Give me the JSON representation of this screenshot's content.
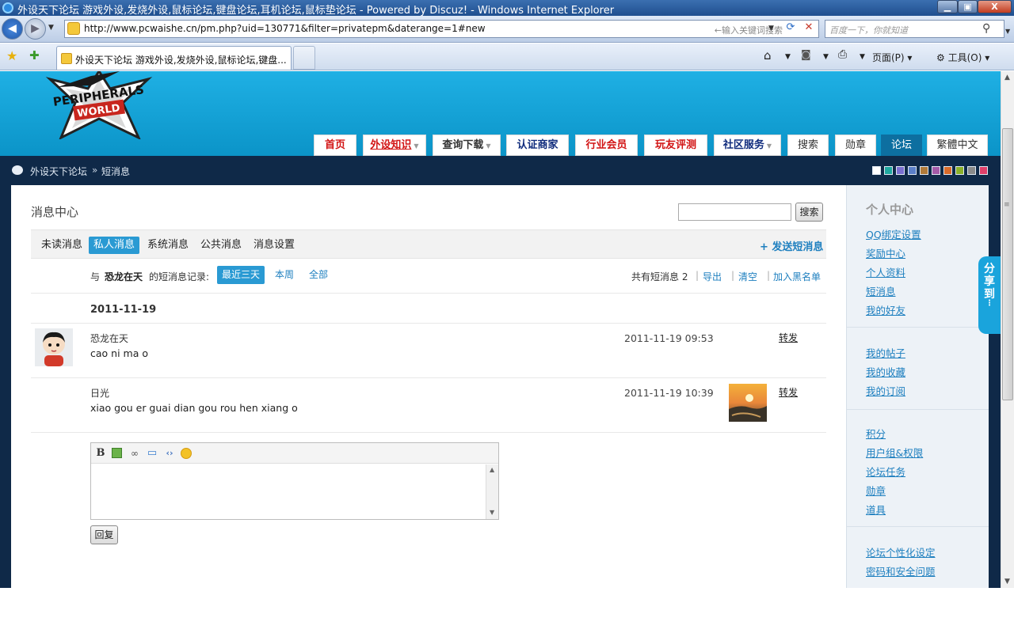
{
  "window": {
    "title": "外设天下论坛 游戏外设,发烧外设,鼠标论坛,键盘论坛,耳机论坛,鼠标垫论坛 - Powered by Discuz! - Windows Internet Explorer",
    "min": "▁",
    "max": "▣",
    "close": "X"
  },
  "browser": {
    "url": "http://www.pcwaishe.cn/pm.php?uid=130771&filter=privatepm&daterange=1#new",
    "address_hint": "←输入关键词搜索",
    "search_placeholder": "百度一下，你就知道",
    "tab_title": "外设天下论坛 游戏外设,发烧外设,鼠标论坛,键盘...",
    "cmd_page": "页面(P) ▾",
    "cmd_tools": "⚙ 工具(O) ▾"
  },
  "site": {
    "logo_text": "PERIPHERALS WORLD",
    "nav": [
      {
        "label": "首页"
      },
      {
        "label": "外设知识"
      },
      {
        "label": "查询下载"
      },
      {
        "label": "认证商家"
      },
      {
        "label": "行业会员"
      },
      {
        "label": "玩友评测"
      },
      {
        "label": "社区服务"
      },
      {
        "label": "搜索"
      },
      {
        "label": "勋章"
      },
      {
        "label": "论坛"
      },
      {
        "label": "繁體中文"
      }
    ],
    "breadcrumb": {
      "home": "外设天下论坛",
      "sep": "»",
      "current": "短消息"
    },
    "swatches": [
      "#ffffff",
      "#1fa8a0",
      "#7a6fd0",
      "#5b7fc8",
      "#b07a3a",
      "#a45aa8",
      "#d96b2a",
      "#8bb02a",
      "#8a8a8a",
      "#e0406a"
    ]
  },
  "main": {
    "title": "消息中心",
    "search_button": "搜索",
    "tabs": [
      {
        "label": "未读消息"
      },
      {
        "label": "私人消息"
      },
      {
        "label": "系统消息"
      },
      {
        "label": "公共消息"
      },
      {
        "label": "消息设置"
      }
    ],
    "send_pm": "+ 发送短消息",
    "filter": {
      "with": "与",
      "user": "恐龙在天",
      "record_label": "的短消息记录:",
      "ranges": [
        {
          "label": "最近三天"
        },
        {
          "label": "本周"
        },
        {
          "label": "全部"
        }
      ],
      "total_label": "共有短消息",
      "total_count": "2",
      "export": "导出",
      "clear": "清空",
      "blacklist": "加入黑名单"
    },
    "date": "2011-11-19",
    "messages": [
      {
        "author": "恐龙在天",
        "text": "cao ni ma o",
        "time": "2011-11-19 09:53",
        "forward": "转发"
      },
      {
        "author": "日光",
        "text": "xiao gou er  guai dian   gou rou hen xiang o",
        "time": "2011-11-19 10:39",
        "forward": "转发"
      }
    ],
    "reply_button": "回复"
  },
  "sidebar": {
    "title": "个人中心",
    "groups": [
      [
        "QQ绑定设置",
        "奖励中心",
        "个人资料",
        "短消息",
        "我的好友"
      ],
      [
        "我的帖子",
        "我的收藏",
        "我的订阅"
      ],
      [
        "积分",
        "用户组&权限",
        "论坛任务",
        "勋章",
        "道具"
      ],
      [
        "论坛个性化设定",
        "密码和安全问题"
      ]
    ]
  },
  "share": {
    "label": "分享到"
  }
}
